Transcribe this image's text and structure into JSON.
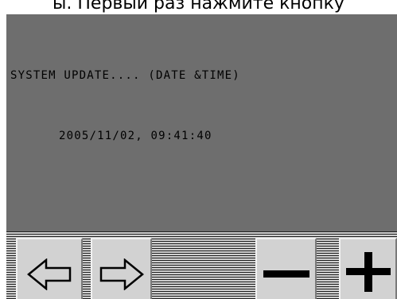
{
  "caption": "ы. Первый раз нажмите кнопку",
  "screen": {
    "line1": "SYSTEM UPDATE.... (DATE &TIME)",
    "line2": "2005/11/02, 09:41:40"
  },
  "softkeys": {
    "icons": [
      "arrow-left-icon",
      "arrow-right-icon",
      "minus-icon",
      "plus-icon"
    ]
  },
  "colors": {
    "screen_bg": "#6e6e6e",
    "key_bg": "#d2d2d2",
    "text": "#000000"
  }
}
